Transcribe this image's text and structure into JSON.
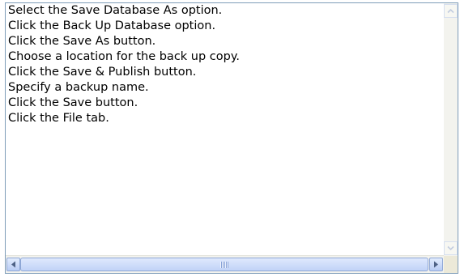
{
  "listbox": {
    "lines": [
      "Select the Save Database As option.",
      "Click the Back Up Database option.",
      "Click the Save As button.",
      "Choose a location for the back up copy.",
      "Click the Save & Publish button.",
      "Specify a backup name.",
      "Click the Save button.",
      "Click the File tab."
    ]
  },
  "scrollbars": {
    "vertical": {
      "position": 0
    },
    "horizontal": {
      "position": 0
    }
  },
  "icons": {
    "scroll_up": "chevron-up-icon",
    "scroll_down": "chevron-down-icon",
    "scroll_left": "triangle-left-icon",
    "scroll_right": "triangle-right-icon",
    "thumb_grip": "grip-icon"
  },
  "colors": {
    "border": "#7f9db9",
    "text": "#000000",
    "scrollbar_track": "#f3f3ee",
    "button_blue": "#c1d3f7"
  }
}
